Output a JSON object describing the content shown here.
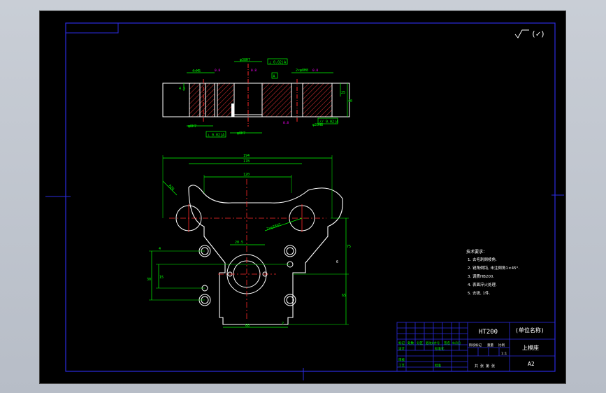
{
  "colors": {
    "background": "#000000",
    "frame": "#2b2be0",
    "outline": "#ffffff",
    "dimension": "#00ff00",
    "centerline": "#ff2a2a",
    "hatch": "#ff3b3b",
    "annotation": "#ff00ff",
    "text": "#ffffff"
  },
  "surface_mark": "(✓)",
  "section_view": {
    "dims": {
      "d1": "φ38H7",
      "d2": "φ20H8",
      "d3": "φ8H7",
      "d4": "2×φ8H8",
      "d5": "25",
      "d6": "40",
      "d7": "4.5",
      "d8": "4×M5",
      "d9": "φ8H7"
    },
    "tol_boxes": {
      "t1": "⊥ 0.02|A",
      "t2": "⊥ 0.02|A",
      "t3": "// 0.02|A",
      "t4": "A"
    },
    "roughness": {
      "r1": "0.8",
      "r2": "0.8",
      "r3": "0.8",
      "r4": "0.8"
    }
  },
  "plan_view": {
    "dims": {
      "w1": "194",
      "w2": "178",
      "w3": "120",
      "w4": "20.5",
      "w5": "60",
      "r1": "R20",
      "h1": "75",
      "h2": "65",
      "h3": "15",
      "h4": "30",
      "d1": "2×φ28H7",
      "d2": "4",
      "d3": "2",
      "d4": "6"
    }
  },
  "notes": {
    "title": "技术要求：",
    "items": [
      "1. 去毛刺倒棱角.",
      "2. 锐角倒钝, 未注倒角1×45°.",
      "3. 调质HB200.",
      "4. 表面淬火处理.",
      "5. 去锐, 1件."
    ]
  },
  "title_block": {
    "material": "HT200",
    "company": "(单位名称)",
    "part_name": "上模座",
    "drawing_no": "A2",
    "scale": "1:1",
    "row_labels": {
      "mark": "标记",
      "count": "处数",
      "zone": "分区",
      "change_no": "更改文件号",
      "sign": "签名",
      "date": "年月日",
      "designer": "设计",
      "standard": "标准化",
      "review": "审核",
      "process": "工艺",
      "approve": "批准",
      "stage": "阶段标记",
      "weight": "重量",
      "ratio": "比例",
      "sheets": "共 张 第 张"
    }
  }
}
